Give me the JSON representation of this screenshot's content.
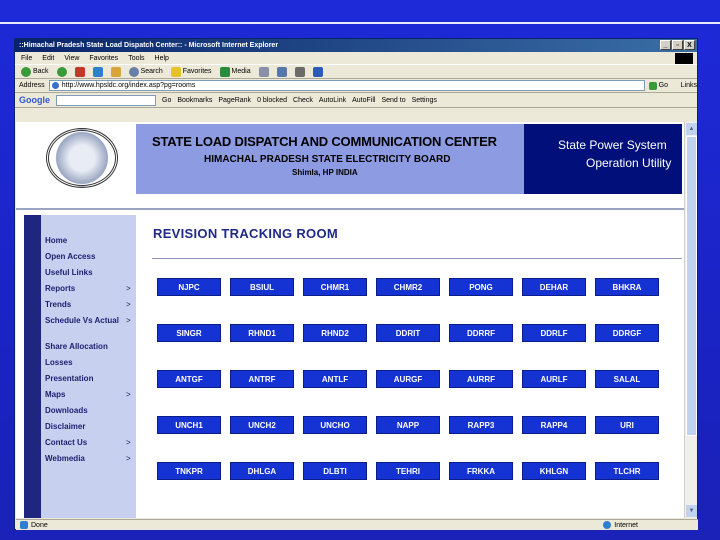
{
  "window": {
    "title": "::Himachal Pradesh State Load Dispatch Center:: - Microsoft Internet Explorer",
    "controls": [
      "_",
      "▫",
      "X"
    ]
  },
  "menu": [
    "File",
    "Edit",
    "View",
    "Favorites",
    "Tools",
    "Help"
  ],
  "toolbar": {
    "back": "Back",
    "search": "Search",
    "favorites": "Favorites",
    "media": "Media"
  },
  "address": {
    "label": "Address",
    "url": "http://www.hpsldc.org/index.asp?pg=rooms",
    "go": "Go",
    "links": "Links"
  },
  "googlebar": {
    "logo": "Google",
    "items": [
      "Go",
      "Bookmarks",
      "PageRank",
      "0 blocked",
      "Check",
      "AutoLink",
      "AutoFill",
      "Send to",
      "Settings"
    ]
  },
  "header": {
    "title": "STATE LOAD DISPATCH AND COMMUNICATION CENTER",
    "subtitle": "HIMACHAL PRADESH STATE ELECTRICITY BOARD",
    "location": "Shimla, HP INDIA",
    "right_line1": "State Power System",
    "right_line2": "Operation Utility"
  },
  "sidebar": {
    "items": [
      {
        "label": "Home",
        "arrow": ""
      },
      {
        "label": "Open Access",
        "arrow": ""
      },
      {
        "label": "Useful Links",
        "arrow": ""
      },
      {
        "label": "Reports",
        "arrow": ">"
      },
      {
        "label": "Trends",
        "arrow": ">"
      },
      {
        "label": "Schedule Vs Actual",
        "arrow": ">"
      },
      {
        "label": "Share Allocation",
        "arrow": ""
      },
      {
        "label": "Losses",
        "arrow": ""
      },
      {
        "label": "Presentation",
        "arrow": ""
      },
      {
        "label": "Maps",
        "arrow": ">"
      },
      {
        "label": "Downloads",
        "arrow": ""
      },
      {
        "label": "Disclaimer",
        "arrow": ""
      },
      {
        "label": "Contact Us",
        "arrow": ">"
      },
      {
        "label": "Webmedia",
        "arrow": ">"
      }
    ]
  },
  "main": {
    "title": "REVISION TRACKING ROOM",
    "rows": [
      [
        "NJPC",
        "BSIUL",
        "CHMR1",
        "CHMR2",
        "PONG",
        "DEHAR",
        "BHKRA"
      ],
      [
        "SINGR",
        "RHND1",
        "RHND2",
        "DDRIT",
        "DDRRF",
        "DDRLF",
        "DDRGF"
      ],
      [
        "ANTGF",
        "ANTRF",
        "ANTLF",
        "AURGF",
        "AURRF",
        "AURLF",
        "SALAL"
      ],
      [
        "UNCH1",
        "UNCH2",
        "UNCHO",
        "NAPP",
        "RAPP3",
        "RAPP4",
        "URI"
      ],
      [
        "TNKPR",
        "DHLGA",
        "DLBTI",
        "TEHRI",
        "FRKKA",
        "KHLGN",
        "TLCHR"
      ]
    ]
  },
  "status": {
    "left": "Done",
    "zone": "Internet"
  }
}
